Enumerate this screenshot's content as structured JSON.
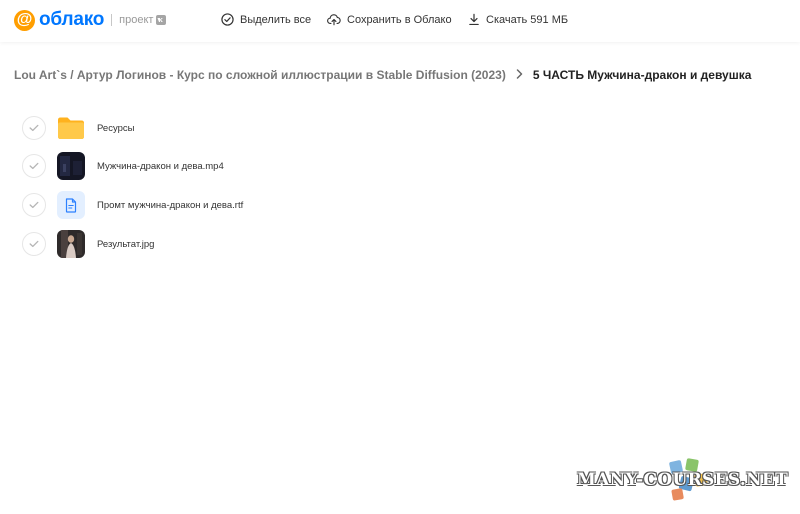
{
  "header": {
    "logo_symbol": "@",
    "logo_text": "облако",
    "project_label": "проект",
    "vk_badge": "vk",
    "brand_color": "#0077ff",
    "logo_accent": "#ff9e00",
    "actions": [
      {
        "label": "Выделить все",
        "icon": "check-circle-icon"
      },
      {
        "label": "Сохранить в Облако",
        "icon": "cloud-upload-icon"
      },
      {
        "label": "Скачать 591 МБ",
        "icon": "download-icon"
      }
    ]
  },
  "breadcrumb": {
    "parent": "Lou Art`s / Артур Логинов - Курс по сложной иллюстрации в Stable Diffusion (2023)",
    "separator_icon": "chevron-right-icon",
    "current": "5 ЧАСТЬ Мужчина-дракон и девушка"
  },
  "files": [
    {
      "name": "Ресурсы",
      "type": "folder",
      "icon": "folder-icon"
    },
    {
      "name": "Мужчина-дракон и дева.mp4",
      "type": "video",
      "icon": "video-thumbnail"
    },
    {
      "name": "Промт мужчина-дракон и дева.rtf",
      "type": "document",
      "icon": "document-icon"
    },
    {
      "name": "Результат.jpg",
      "type": "image",
      "icon": "image-thumbnail"
    }
  ],
  "watermark": "MANY-COURSES.NET"
}
